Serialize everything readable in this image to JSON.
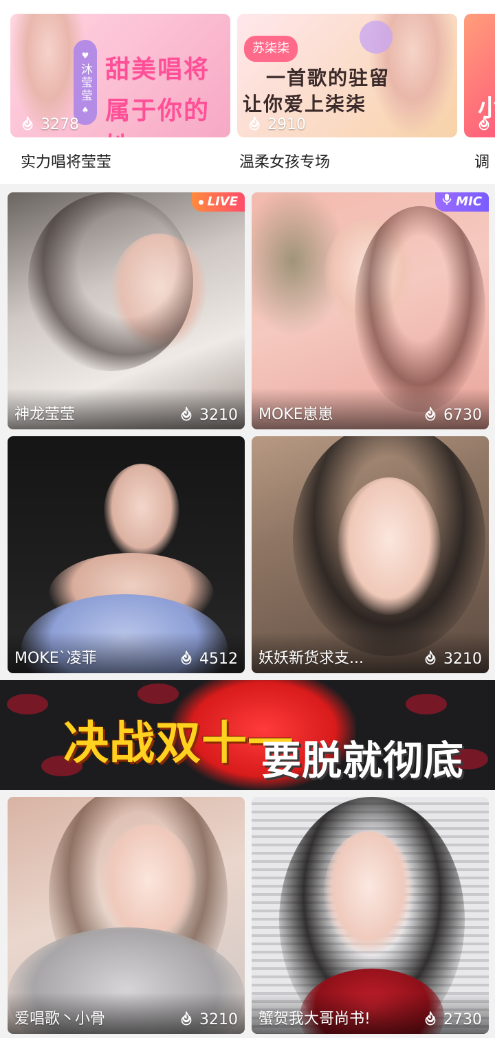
{
  "banners": [
    {
      "vertical_tag": "沐莹莹",
      "headline_1": "甜美唱将",
      "headline_2": "属于你的她",
      "hot_count": "3278",
      "title": "实力唱将莹莹"
    },
    {
      "pill": "苏柒柒",
      "headline_1": "一首歌的驻留",
      "headline_2": "让你爱上柒柒",
      "hot_count": "2910",
      "title": "温柔女孩专场"
    },
    {
      "headline_1": "小",
      "title": "调"
    }
  ],
  "cards": [
    {
      "name": "神龙莹莹",
      "count": "3210",
      "badge": "LIVE"
    },
    {
      "name": "MOKE崽崽",
      "count": "6730",
      "badge": "MIC"
    },
    {
      "name": "MOKE`凌菲",
      "count": "4512"
    },
    {
      "name": "妖妖新货求支...",
      "count": "3210"
    },
    {
      "name": "爱唱歌丶小骨",
      "count": "3210"
    },
    {
      "name": "蟹贺我大哥尚书!",
      "count": "2730"
    }
  ],
  "promo": {
    "text_main": "决战双十一",
    "text_sub": "要脱就彻底"
  },
  "colors": {
    "live_badge": "#ff4d6a",
    "mic_badge": "#7a5cff",
    "promo_yellow": "#ffd21f"
  },
  "icons": [
    "flame-icon",
    "live-dot-icon",
    "mic-icon"
  ]
}
